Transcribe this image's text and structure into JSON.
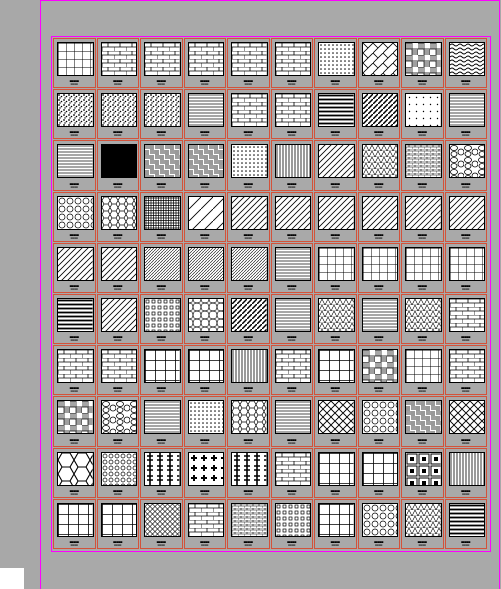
{
  "canvas": {
    "background": "#a9a9a9",
    "frame_color": "#ff00ff",
    "cell_border": "#d3523a"
  },
  "rows": 10,
  "cols": 10,
  "patterns": [
    [
      "grid",
      "brick",
      "brick",
      "brick",
      "brick",
      "brick",
      "dots",
      "herring",
      "parquet",
      "wave"
    ],
    [
      "noise",
      "noise",
      "noise",
      "lines-h",
      "brick",
      "brick",
      "lines-h-thick",
      "diag-thick",
      "dots-sparse",
      "lines-h"
    ],
    [
      "lines-h",
      "solid",
      "weave",
      "weave",
      "dots",
      "vert-dense",
      "diag",
      "triangles",
      "brick-dense",
      "stones"
    ],
    [
      "hex-circles",
      "hex",
      "crosshatch-dense",
      "diag-sparse",
      "diag",
      "diag",
      "diag",
      "diag",
      "diag",
      "diag"
    ],
    [
      "diag",
      "diag",
      "diag-dense",
      "diag-dense",
      "diag-dense",
      "lines-h",
      "grid",
      "grid",
      "grid",
      "grid"
    ],
    [
      "lines-h-thick",
      "diag",
      "grid-dots",
      "star",
      "diag-thick",
      "lines-h",
      "triangles",
      "lines-h",
      "triangles",
      "brick"
    ],
    [
      "brick",
      "brick",
      "grid-big",
      "grid-big",
      "vert-dense",
      "brick",
      "grid-big",
      "parquet",
      "grid",
      "brick"
    ],
    [
      "parquet",
      "stones",
      "lines-h",
      "dots",
      "hex",
      "lines-h",
      "diamond",
      "hex-circles",
      "weave",
      "diamond"
    ],
    [
      "hex-big",
      "circles",
      "ornament",
      "cross",
      "ornament",
      "brick",
      "grid-big",
      "grid-big",
      "square-ornament",
      "vert-dense"
    ],
    [
      "grid-big",
      "grid-big",
      "diamond-small",
      "brick",
      "brick-dense",
      "grid-dots",
      "grid-big",
      "hex-circles",
      "triangles",
      "lines-h-thick"
    ]
  ]
}
